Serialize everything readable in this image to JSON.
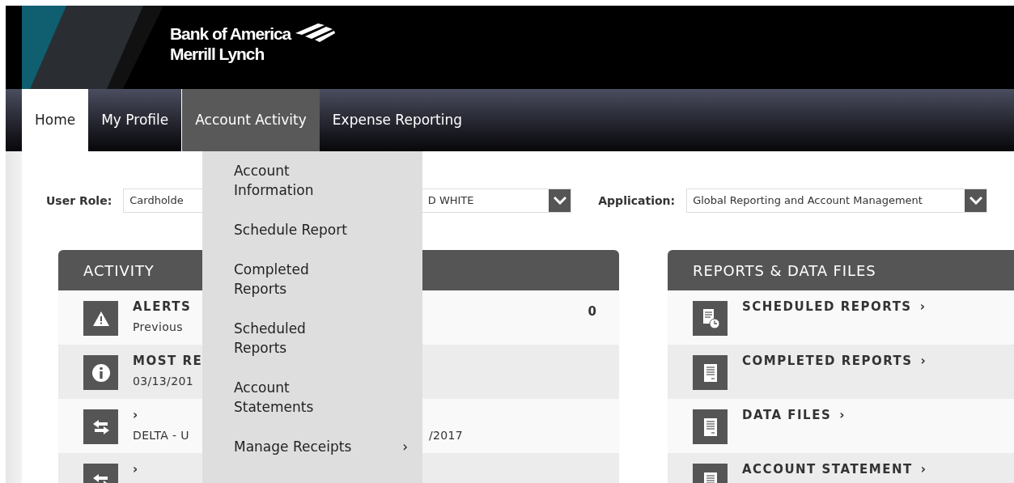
{
  "header": {
    "logo": {
      "line_1": "Bank of America",
      "line_2": "Merrill Lynch"
    }
  },
  "nav": {
    "tabs": [
      {
        "label": "Home",
        "selected": true,
        "open": false
      },
      {
        "label": "My Profile",
        "selected": false,
        "open": false
      },
      {
        "label": "Account Activity",
        "selected": false,
        "open": true
      },
      {
        "label": "Expense Reporting",
        "selected": false,
        "open": false
      }
    ]
  },
  "nav_menu": {
    "items": [
      {
        "label": "Account Information"
      },
      {
        "label": "Schedule Report"
      },
      {
        "label": "Completed Reports"
      },
      {
        "label": "Scheduled Reports"
      },
      {
        "label": "Account Statements"
      },
      {
        "label": "Manage Receipts",
        "arrow": "›"
      }
    ]
  },
  "filters": [
    {
      "label": "User Role:",
      "value_start": "Cardholde",
      "value_end": "D WHITE"
    },
    {
      "label": "Application:",
      "value_start": "Global Reporting and Account Management"
    }
  ],
  "activity": {
    "title": "ACTIVITY",
    "rows": [
      {
        "kind": "alert",
        "title": "ALERTS",
        "subtitle": "Previous",
        "count": "0"
      },
      {
        "kind": "info",
        "title": "MOST RE",
        "subtitle": "03/13/201"
      },
      {
        "kind": "transfer",
        "title": "›",
        "subtitle": "DELTA - U",
        "subtitle_end": "/2017"
      },
      {
        "kind": "transfer",
        "title": "›"
      }
    ]
  },
  "reports": {
    "title": "REPORTS & DATA FILES",
    "rows": [
      {
        "kind": "scheduled",
        "title": "SCHEDULED REPORTS",
        "arrow": "›"
      },
      {
        "kind": "document",
        "title": "COMPLETED REPORTS",
        "arrow": "›"
      },
      {
        "kind": "document",
        "title": "DATA FILES",
        "arrow": "›"
      },
      {
        "kind": "document",
        "title": "ACCOUNT STATEMENT",
        "arrow": "›"
      }
    ]
  }
}
